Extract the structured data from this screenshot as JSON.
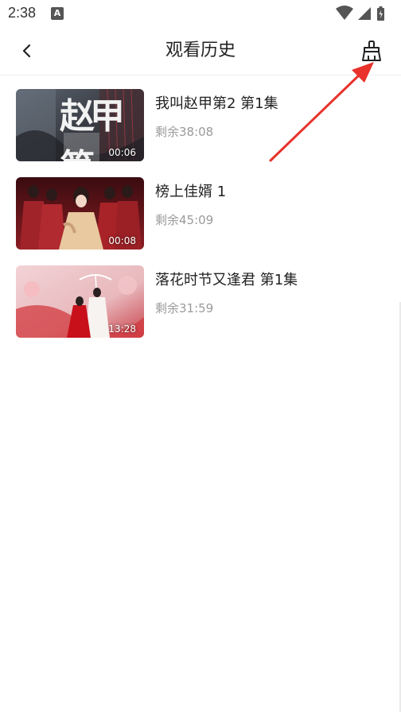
{
  "status_bar": {
    "time": "2:38",
    "app_icon_letter": "A",
    "icons": [
      "wifi-icon",
      "signal-icon",
      "battery-icon"
    ]
  },
  "header": {
    "title": "观看历史",
    "back_icon": "back-arrow-icon",
    "clear_icon": "broom-icon"
  },
  "history": [
    {
      "title": "我叫赵甲第2 第1集",
      "remaining": "剩余38:08",
      "duration": "00:06",
      "thumb_text": "赵甲第"
    },
    {
      "title": "榜上佳婿 1",
      "remaining": "剩余45:09",
      "duration": "00:08",
      "thumb_text": ""
    },
    {
      "title": "落花时节又逢君 第1集",
      "remaining": "剩余31:59",
      "duration": "13:28",
      "thumb_text": ""
    }
  ],
  "colors": {
    "annotation_arrow": "#e8322b",
    "secondary_text": "#9a9a9a",
    "divider": "#efefef"
  }
}
